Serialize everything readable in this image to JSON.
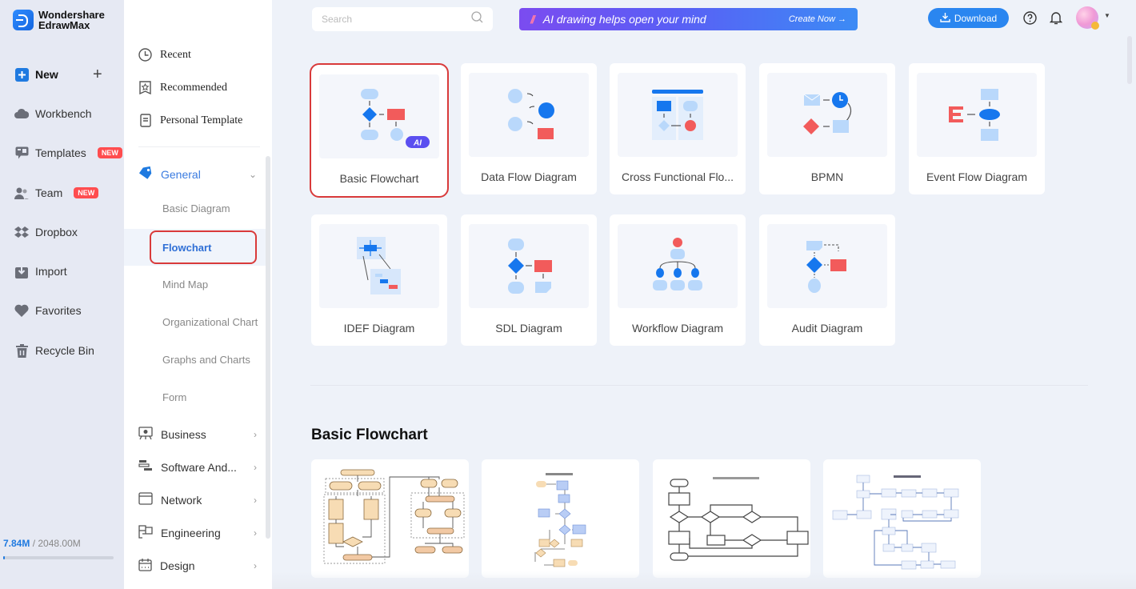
{
  "app": {
    "brand_line1": "Wondershare",
    "brand_line2": "EdrawMax"
  },
  "sidebar": {
    "new_label": "New",
    "items": [
      {
        "label": "Workbench",
        "icon": "cloud-icon"
      },
      {
        "label": "Templates",
        "icon": "templates-icon",
        "badge": "NEW"
      },
      {
        "label": "Team",
        "icon": "team-icon",
        "badge": "NEW"
      },
      {
        "label": "Dropbox",
        "icon": "dropbox-icon"
      },
      {
        "label": "Import",
        "icon": "import-icon"
      },
      {
        "label": "Favorites",
        "icon": "heart-icon"
      },
      {
        "label": "Recycle Bin",
        "icon": "trash-icon"
      }
    ],
    "storage": {
      "used": "7.84M",
      "separator": " / ",
      "total": "2048.00M",
      "fraction": 0.0038
    }
  },
  "categories": {
    "top": [
      {
        "label": "Recent",
        "icon": "clock-icon"
      },
      {
        "label": "Recommended",
        "icon": "badge-star-icon"
      },
      {
        "label": "Personal Template",
        "icon": "document-icon"
      }
    ],
    "general": {
      "label": "General",
      "expanded": true,
      "subitems": [
        "Basic Diagram",
        "Flowchart",
        "Mind Map",
        "Organizational Chart",
        "Graphs and Charts",
        "Form"
      ],
      "selected": "Flowchart"
    },
    "groups": [
      {
        "label": "Business",
        "icon": "presentation-icon"
      },
      {
        "label": "Software And...",
        "icon": "software-icon"
      },
      {
        "label": "Network",
        "icon": "network-icon"
      },
      {
        "label": "Engineering",
        "icon": "engineering-icon"
      },
      {
        "label": "Design",
        "icon": "design-icon"
      }
    ]
  },
  "topbar": {
    "search_placeholder": "Search",
    "banner_text": "AI drawing helps open your mind",
    "banner_cta": "Create Now →",
    "download_label": "Download"
  },
  "diagram_types": [
    {
      "label": "Basic Flowchart",
      "badge": "AI",
      "selected": true
    },
    {
      "label": "Data Flow Diagram"
    },
    {
      "label": "Cross Functional Flo..."
    },
    {
      "label": "BPMN"
    },
    {
      "label": "Event Flow Diagram"
    },
    {
      "label": "IDEF Diagram"
    },
    {
      "label": "SDL Diagram"
    },
    {
      "label": "Workflow Diagram"
    },
    {
      "label": "Audit Diagram"
    }
  ],
  "section": {
    "title": "Basic Flowchart",
    "template_count_visible": 4
  },
  "colors": {
    "accent": "#2a86f0",
    "selection": "#d93a3a",
    "badge": "#ff4d4f",
    "light_blue": "#b9d8fb",
    "red": "#f25b5b",
    "blue": "#1677ee"
  }
}
